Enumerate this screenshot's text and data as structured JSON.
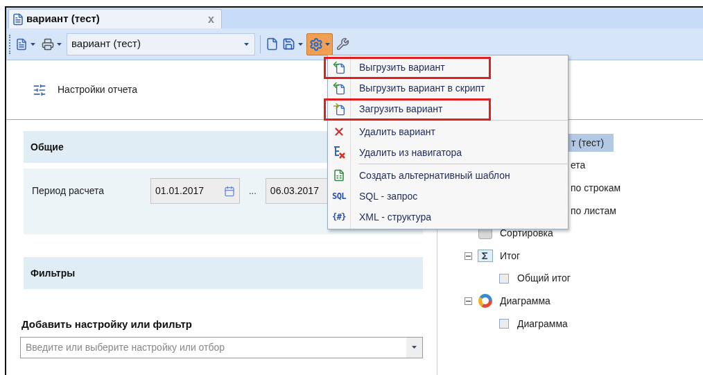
{
  "tab": {
    "title": "вариант (тест)",
    "close": "x",
    "selected": true
  },
  "toolbar": {
    "variant_select": "вариант (тест)",
    "settings_pressed": true
  },
  "header": {
    "title": "Настройки отчета"
  },
  "general": {
    "title": "Общие",
    "fields": [
      {
        "label": "Период расчета",
        "from": "01.01.2017",
        "separator": "...",
        "to": "06.03.2017"
      }
    ]
  },
  "filters": {
    "title": "Фильтры"
  },
  "add": {
    "label": "Добавить настройку или фильтр",
    "placeholder": "Введите или выберите настройку или отбор"
  },
  "menu": {
    "groups": [
      [
        {
          "label": "Выгрузить вариант",
          "kind": "export",
          "highlighted": true
        },
        {
          "label": "Выгрузить вариант в скрипт",
          "kind": "export",
          "highlighted": false
        },
        {
          "label": "Загрузить вариант",
          "kind": "import",
          "highlighted": true
        }
      ],
      [
        {
          "label": "Удалить вариант",
          "kind": "delete",
          "highlighted": false
        },
        {
          "label": "Удалить из навигатора",
          "kind": "remove",
          "highlighted": false
        }
      ],
      [
        {
          "label": "Создать альтернативный шаблон",
          "kind": "template",
          "highlighted": false
        },
        {
          "label": "SQL - запрос",
          "kind": "text",
          "icon_text": "SQL",
          "highlighted": false
        },
        {
          "label": "XML - структура",
          "kind": "text",
          "icon_text": "{#}",
          "highlighted": false
        }
      ]
    ]
  },
  "tree": [
    {
      "label": "т (тест)",
      "kind": "partial",
      "selected": true,
      "children": [
        {
          "label": "ета",
          "kind": "partial",
          "selected": false
        },
        {
          "label": "по строкам",
          "kind": "partial",
          "selected": false
        },
        {
          "label": "по листам",
          "kind": "partial",
          "selected": false
        },
        {
          "label": "Сортировка",
          "kind": "sort",
          "selected": false
        },
        {
          "label": "Итог",
          "kind": "sum",
          "selected": false,
          "expanded": true,
          "children": [
            {
              "label": "Общий итог",
              "kind": "check",
              "checked": false,
              "selected": false
            }
          ]
        },
        {
          "label": "Диаграмма",
          "kind": "chart",
          "selected": false,
          "expanded": true,
          "children": [
            {
              "label": "Диаграмма",
              "kind": "check",
              "checked": false,
              "selected": false
            }
          ]
        }
      ]
    }
  ]
}
